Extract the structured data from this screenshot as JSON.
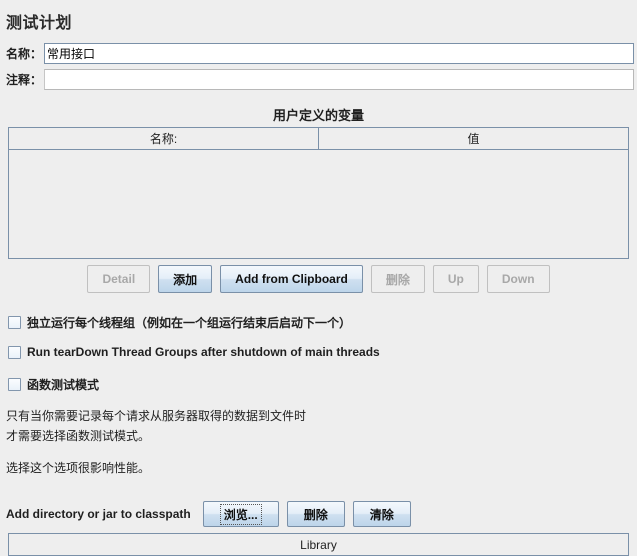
{
  "panel": {
    "title": "测试计划"
  },
  "fields": {
    "name_label": "名称：",
    "name_value": "常用接口",
    "comment_label": "注释：",
    "comment_value": ""
  },
  "variables": {
    "section_title": "用户定义的变量",
    "columns": [
      "名称:",
      "值"
    ],
    "rows": []
  },
  "buttons": [
    {
      "label": "Detail",
      "enabled": false
    },
    {
      "label": "添加",
      "enabled": true
    },
    {
      "label": "Add from Clipboard",
      "enabled": true
    },
    {
      "label": "删除",
      "enabled": false
    },
    {
      "label": "Up",
      "enabled": false
    },
    {
      "label": "Down",
      "enabled": false
    }
  ],
  "checkboxes": [
    {
      "label": "独立运行每个线程组（例如在一个组运行结束后启动下一个）",
      "checked": false
    },
    {
      "label": "Run tearDown Thread Groups after shutdown of main threads",
      "checked": false
    },
    {
      "label": "函数测试模式",
      "checked": false
    }
  ],
  "description": {
    "line1": "只有当你需要记录每个请求从服务器取得的数据到文件时",
    "line2": "才需要选择函数测试模式。",
    "line3": "选择这个选项很影响性能。"
  },
  "classpath": {
    "label": "Add directory or jar to classpath",
    "browse_label": "浏览...",
    "delete_label": "删除",
    "clear_label": "清除"
  },
  "library": {
    "column": "Library",
    "rows": []
  },
  "colors": {
    "background": "#eeeeee",
    "border_blue": "#7a90a8",
    "disabled_text": "#a8a8a8",
    "text": "#1f1f1f"
  }
}
